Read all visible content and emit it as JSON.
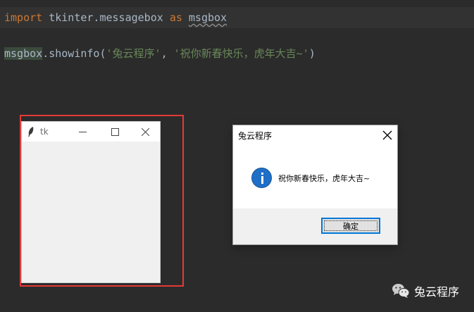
{
  "editor": {
    "line1": {
      "import_kw": "import",
      "module": "tkinter.messagebox",
      "as_kw": "as",
      "alias": "msgbox"
    },
    "line2": {
      "obj": "msgbox",
      "call": ".showinfo(",
      "arg1": "'兔云程序'",
      "sep": ", ",
      "arg2": "'祝你新春快乐，虎年大吉~'",
      "close": ")"
    }
  },
  "tk_window": {
    "title": "tk",
    "icons": [
      "feather-icon",
      "minimize-icon",
      "maximize-icon",
      "close-icon"
    ]
  },
  "messagebox": {
    "title": "兔云程序",
    "message": "祝你新春快乐，虎年大吉~",
    "ok_label": "确定",
    "icon": "info-icon"
  },
  "watermark": {
    "text": "兔云程序",
    "icon": "wechat-icon"
  },
  "colors": {
    "editor_bg": "#2b2b2b",
    "keyword": "#cc7832",
    "string": "#6a8759",
    "identifier": "#a9b7c6",
    "annotation_red": "#e53935",
    "info_blue": "#1f6fc6",
    "focus_blue": "#0078d7"
  }
}
